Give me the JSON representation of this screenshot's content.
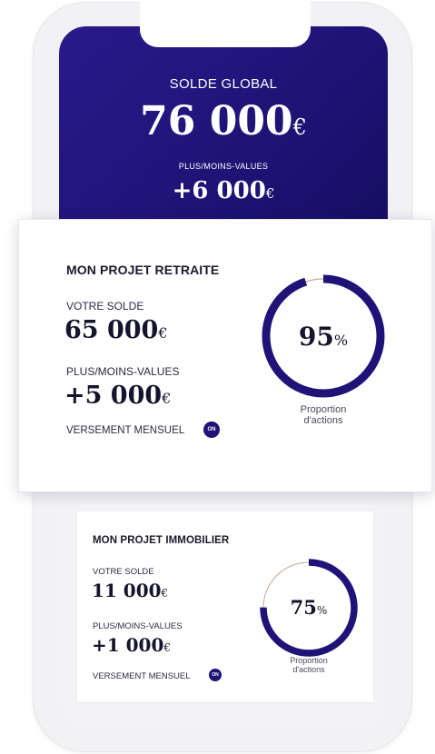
{
  "global": {
    "label": "SOLDE GLOBAL",
    "amount": "76 000",
    "currency": "€",
    "pl_label": "PLUS/MOINS-VALUES",
    "pl_amount": "+6 000",
    "pl_currency": "€"
  },
  "retraite": {
    "title": "MON PROJET RETRAITE",
    "balance_label": "VOTRE SOLDE",
    "balance": "65 000",
    "currency": "€",
    "pl_label": "PLUS/MOINS-VALUES",
    "pl_amount": "+5 000",
    "monthly_label": "VERSEMENT MENSUEL",
    "toggle": "ON",
    "proportion_value": "95",
    "proportion_percent": 95,
    "percent_sign": "%",
    "proportion_caption_1": "Proportion",
    "proportion_caption_2": "d'actions"
  },
  "immobilier": {
    "title": "MON PROJET IMMOBILIER",
    "balance_label": "VOTRE SOLDE",
    "balance": "11 000",
    "currency": "€",
    "pl_label": "PLUS/MOINS-VALUES",
    "pl_amount": "+1 000",
    "monthly_label": "VERSEMENT MENSUEL",
    "toggle": "ON",
    "proportion_value": "75",
    "proportion_percent": 75,
    "percent_sign": "%",
    "proportion_caption_1": "Proportion",
    "proportion_caption_2": "d'actions"
  },
  "colors": {
    "primary": "#1f1377",
    "donut_rest": "#c9a98c"
  }
}
